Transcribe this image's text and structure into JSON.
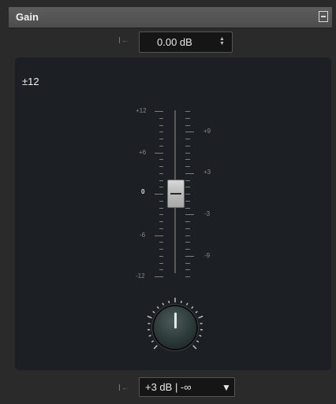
{
  "panel": {
    "title": "Gain"
  },
  "gain_field": {
    "value": "0.00 dB"
  },
  "meter": {
    "range_label": "±12",
    "left_scale": [
      "+12",
      "+6",
      "0",
      "-6",
      "-12"
    ],
    "right_scale": [
      "+9",
      "+3",
      "-3",
      "-9"
    ],
    "fader_value_db": 3
  },
  "range_selector": {
    "value": "+3 dB | -∞"
  },
  "colors": {
    "panel_bg": "#2a2a2a",
    "meter_bg": "#1c1f24",
    "titlebar": "#555555"
  },
  "icons": {
    "reset": "reset-to-default-icon",
    "collapse": "collapse-panel-icon",
    "spin": "up-down-spinner-icon",
    "dropdown": "dropdown-triangle-icon"
  }
}
